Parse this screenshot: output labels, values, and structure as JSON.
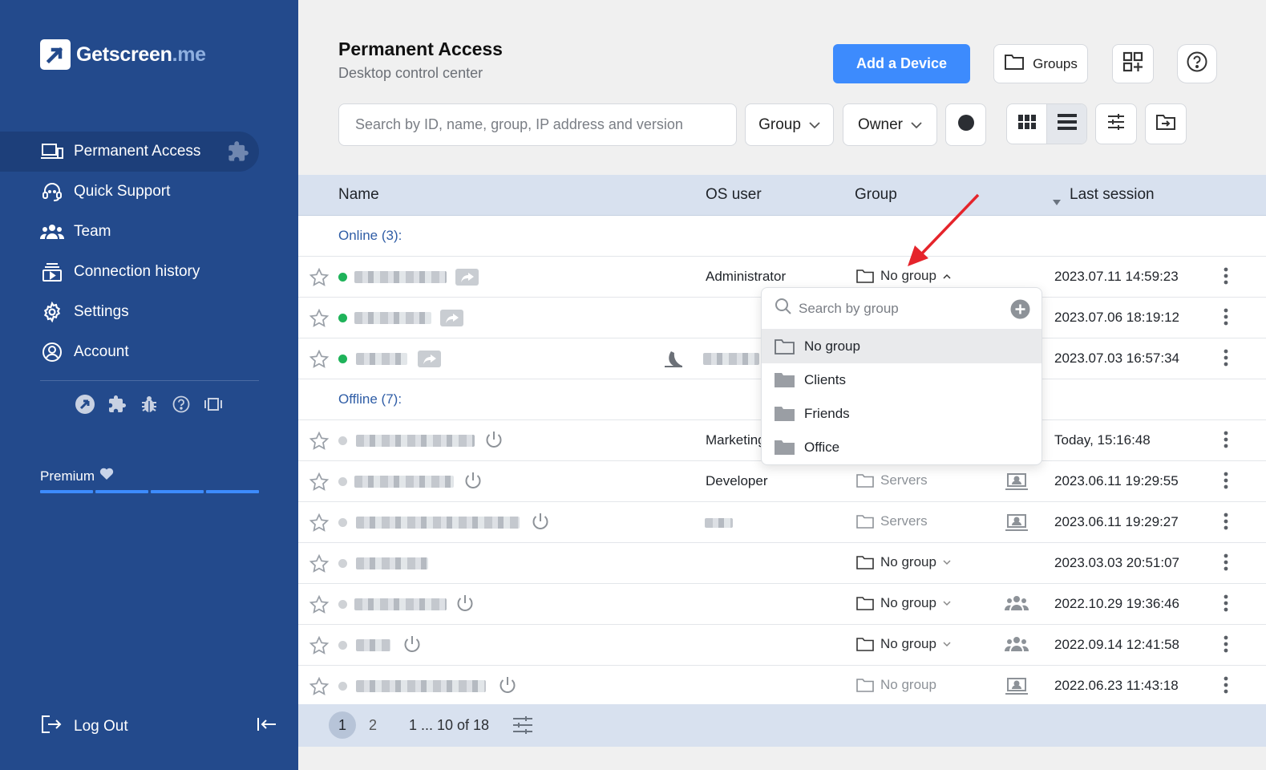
{
  "brand": {
    "name": "Getscreen",
    "suffix": ".me"
  },
  "sidebar": {
    "items": [
      {
        "label": "Permanent Access",
        "icon": "devices-icon",
        "active": true
      },
      {
        "label": "Quick Support",
        "icon": "headset-icon"
      },
      {
        "label": "Team",
        "icon": "team-icon"
      },
      {
        "label": "Connection history",
        "icon": "history-icon"
      },
      {
        "label": "Settings",
        "icon": "gear-icon"
      },
      {
        "label": "Account",
        "icon": "account-icon"
      }
    ],
    "tools": [
      "getscreen-logo-icon",
      "puzzle-icon",
      "bug-icon",
      "help-icon",
      "carousel-icon"
    ],
    "plan": "Premium",
    "logout": "Log Out"
  },
  "header": {
    "title": "Permanent Access",
    "subtitle": "Desktop control center",
    "add_device": "Add a Device",
    "groups": "Groups"
  },
  "toolbar": {
    "search_placeholder": "Search by ID, name, group, IP address and version",
    "group_filter": "Group",
    "owner_filter": "Owner"
  },
  "table": {
    "columns": {
      "name": "Name",
      "os_user": "OS user",
      "group": "Group",
      "last_session": "Last session"
    },
    "online_label": "Online (3):",
    "offline_label": "Offline (7):",
    "online": [
      {
        "os_user": "Administrator",
        "group": "No group",
        "session": "2023.07.11 14:59:23"
      },
      {
        "os_user": "",
        "group": "",
        "session": "2023.07.06 18:19:12"
      },
      {
        "os_user": "",
        "group": "",
        "session": "2023.07.03 16:57:34"
      }
    ],
    "offline": [
      {
        "os_user": "Marketing",
        "group": "",
        "session": "Today, 15:16:48"
      },
      {
        "os_user": "Developer",
        "group": "Servers",
        "session": "2023.06.11 19:29:55"
      },
      {
        "os_user": "",
        "group": "Servers",
        "session": "2023.06.11 19:29:27"
      },
      {
        "os_user": "",
        "group": "No group",
        "session": "2023.03.03 20:51:07"
      },
      {
        "os_user": "",
        "group": "No group",
        "session": "2022.10.29 19:36:46"
      },
      {
        "os_user": "",
        "group": "No group",
        "session": "2022.09.14 12:41:58"
      },
      {
        "os_user": "",
        "group": "No group",
        "session": "2022.06.23 11:43:18"
      }
    ]
  },
  "group_popup": {
    "search_placeholder": "Search by group",
    "options": [
      "No group",
      "Clients",
      "Friends",
      "Office"
    ]
  },
  "pagination": {
    "current": "1",
    "next": "2",
    "range": "1 ... 10 of 18"
  },
  "colors": {
    "sidebar": "#234a8c",
    "accent": "#3d8bfd",
    "online": "#1fb35a",
    "header_row": "#d8e1ef"
  }
}
